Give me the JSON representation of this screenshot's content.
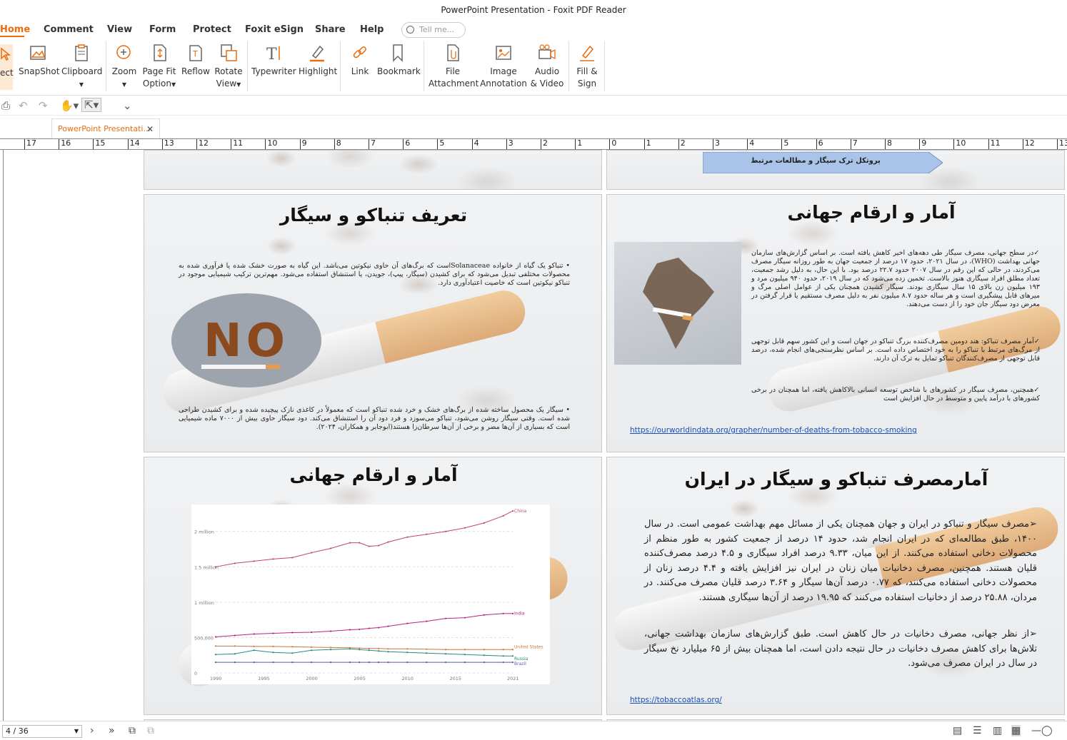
{
  "window": {
    "title": "PowerPoint Presentation - Foxit PDF Reader"
  },
  "menu": {
    "items": [
      "Home",
      "Comment",
      "View",
      "Form",
      "Protect",
      "Foxit eSign",
      "Share",
      "Help"
    ],
    "tell_me_placeholder": "Tell me..."
  },
  "ribbon": {
    "select": "ect",
    "snapshot": "SnapShot",
    "clipboard": "Clipboard",
    "zoom": "Zoom",
    "page_fit_1": "Page Fit",
    "page_fit_2": "Option",
    "reflow": "Reflow",
    "rotate_1": "Rotate",
    "rotate_2": "View",
    "typewriter": "Typewriter",
    "highlight": "Highlight",
    "link": "Link",
    "bookmark": "Bookmark",
    "file_attach_1": "File",
    "file_attach_2": "Attachment",
    "image_annot_1": "Image",
    "image_annot_2": "Annotation",
    "audio_video_1": "Audio",
    "audio_video_2": "& Video",
    "fill_sign_1": "Fill &",
    "fill_sign_2": "Sign"
  },
  "tab": {
    "label": "PowerPoint Presentati..."
  },
  "ruler": {
    "labels": [
      "17",
      "16",
      "15",
      "14",
      "13",
      "12",
      "11",
      "10",
      "9",
      "8",
      "7",
      "6",
      "5",
      "4",
      "3",
      "2",
      "1",
      "0",
      "1",
      "2",
      "3",
      "4",
      "5",
      "6",
      "7",
      "8",
      "9",
      "10",
      "11",
      "12",
      "13"
    ]
  },
  "slides": {
    "banner_text": "پروتکل ترک سیگار و مطالعات مرتبط",
    "global_title": "آمار و ارقام جهانی",
    "global_p1": "در سطح جهانی، مصرف سیگار طی دهه‌های اخیر کاهش یافته است. بر اساس گزارش‌های سازمان جهانی بهداشت (WHO)، در سال ۲۰۲۱، حدود ۱۷ درصد از جمعیت جهان به طور روزانه سیگار مصرف می‌کردند، در حالی که این رقم در سال ۲۰۰۷ حدود ۲۲.۷ درصد بود. با این حال، به دلیل رشد جمعیت، تعداد مطلق افراد سیگاری هنوز بالاست. تخمین زده می‌شود که در سال ۲۰۱۹، حدود ۹۴۰ میلیون مرد و ۱۹۳ میلیون زن بالای ۱۵ سال سیگاری بودند. سیگار کشیدن همچنان یکی از عوامل اصلی مرگ و میرهای قابل پیشگیری است و هر ساله حدود ۸.۷ میلیون نفر به دلیل مصرف مستقیم یا قرار گرفتن در معرض دود سیگار جان خود را از دست می‌دهند.",
    "global_p2": "آمار مصرف تنباکو: هند دومین مصرف‌کننده بزرگ تنباکو در جهان است و این کشور سهم قابل توجهی از مرگ‌های مرتبط با تنباکو را به خود اختصاص داده است. بر اساس نظرسنجی‌های انجام شده، درصد قابل توجهی از مصرف‌کنندگان تنباکو تمایل به ترک آن دارند.",
    "global_p3": "همچنین، مصرف سیگار در کشورهای با شاخص توسعه انسانی بالاکاهش یافته، اما همچنان در برخی کشورهای با درآمد پایین و متوسط در حال افزایش است",
    "global_link": "https://ourworldindata.org/grapher/number-of-deaths-from-tobacco-smoking",
    "definition_title": "تعریف تنباکو و سیگار",
    "definition_p1": "تنباکو یک گیاه از خانواده Solanaceaeاست که برگ‌های آن حاوی نیکوتین می‌باشد. این گیاه به صورت خشک شده یا فرآوری شده به محصولات مختلفی تبدیل می‌شود که برای کشیدن (سیگار، پیپ)، جویدن، یا استنشاق استفاده می‌شود. مهم‌ترین ترکیب شیمیایی موجود در تنباکو نیکوتین است که خاصیت اعتیادآوری دارد.",
    "no_text": "NO",
    "definition_p2": "سیگار یک محصول ساخته شده از برگ‌های خشک و خرد شده تنباکو است که معمولاً در کاغذی نازک پیچیده شده و برای کشیدن طراحی شده است. وقتی سیگار روشن می‌شود، تنباکو می‌سوزد و فرد دود آن را استنشاق می‌کند. دود سیگار حاوی بیش از ۷۰۰۰ ماده شیمیایی است که بسیاری از آن‌ها مضر و برخی از آن‌ها سرطان‌زا هستند(ابوجابر و همکاران، ۲۰۲۴).",
    "iran_title": "آمارمصرف تنباکو و سیگار در ایران",
    "iran_p1": "مصرف سیگار و تنباکو در ایران و جهان همچنان یکی از مسائل مهم بهداشت عمومی است. در سال ۱۴۰۰، طبق مطالعه‌ای که در ایران انجام شد، حدود ۱۴ درصد از جمعیت کشور به طور منظم از محصولات دخانی استفاده می‌کنند. از این میان، ۹.۳۳ درصد افراد سیگاری و ۴.۵ درصد مصرف‌کننده قلیان هستند. همچنین، مصرف دخانیات میان زنان در ایران نیز افزایش یافته و ۴.۴ درصد زنان از محصولات دخانی استفاده می‌کنند، که ۰.۷۷ درصد آن‌ها سیگار و ۳.۶۴ درصد قلیان مصرف می‌کنند. در مردان، ۲۵.۸۸ درصد از دخانیات استفاده می‌کنند که ۱۹.۹۵ درصد از آن‌ها سیگاری هستند.",
    "iran_p2": "از نظر جهانی، مصرف دخانیات در حال کاهش است. طبق گزارش‌های سازمان بهداشت جهانی، تلاش‌ها برای کاهش مصرف دخانیات در حال نتیجه دادن است، اما همچنان بیش از ۶۵ میلیارد نخ سیگار در سال در ایران مصرف می‌شود.",
    "iran_link": "https://tobaccoatlas.org/",
    "chart_title": "آمار و ارقام جهانی"
  },
  "chart_data": {
    "type": "line",
    "x": [
      1990,
      1992,
      1994,
      1996,
      1998,
      2000,
      2002,
      2004,
      2005,
      2006,
      2007,
      2008,
      2010,
      2012,
      2014,
      2016,
      2018,
      2020,
      2021
    ],
    "series": [
      {
        "name": "China",
        "color": "#c2456a",
        "values": [
          1500000,
          1550000,
          1580000,
          1610000,
          1630000,
          1700000,
          1760000,
          1840000,
          1840000,
          1790000,
          1800000,
          1850000,
          1920000,
          1960000,
          2000000,
          2050000,
          2120000,
          2220000,
          2290000
        ]
      },
      {
        "name": "India",
        "color": "#b8237a",
        "values": [
          510000,
          530000,
          550000,
          560000,
          570000,
          575000,
          590000,
          610000,
          615000,
          630000,
          640000,
          660000,
          700000,
          730000,
          770000,
          780000,
          820000,
          840000,
          840000
        ]
      },
      {
        "name": "United States",
        "color": "#c8793f",
        "values": [
          380000,
          380000,
          375000,
          375000,
          370000,
          365000,
          360000,
          355000,
          350000,
          345000,
          345000,
          340000,
          340000,
          335000,
          330000,
          330000,
          330000,
          330000,
          330000
        ]
      },
      {
        "name": "Russia",
        "color": "#2e8a7a",
        "values": [
          260000,
          270000,
          320000,
          290000,
          280000,
          320000,
          330000,
          340000,
          330000,
          320000,
          310000,
          300000,
          290000,
          280000,
          270000,
          260000,
          250000,
          240000,
          240000
        ]
      },
      {
        "name": "Brazil",
        "color": "#5a5aa8",
        "values": [
          150000,
          150000,
          150000,
          150000,
          150000,
          150000,
          150000,
          150000,
          150000,
          150000,
          150000,
          150000,
          150000,
          150000,
          150000,
          150000,
          150000,
          150000,
          150000
        ]
      }
    ],
    "y_ticks": [
      {
        "value": 2000000,
        "label": "2 million"
      },
      {
        "value": 1500000,
        "label": "1.5 million"
      },
      {
        "value": 1000000,
        "label": "1 million"
      },
      {
        "value": 500000,
        "label": "500,000"
      },
      {
        "value": 0,
        "label": "0"
      }
    ],
    "x_ticks": [
      "1990",
      "1995",
      "2000",
      "2005",
      "2010",
      "2015",
      "2021"
    ],
    "ylim": [
      0,
      2300000
    ],
    "xlim": [
      1990,
      2021
    ]
  },
  "status": {
    "page": "4 / 36"
  }
}
